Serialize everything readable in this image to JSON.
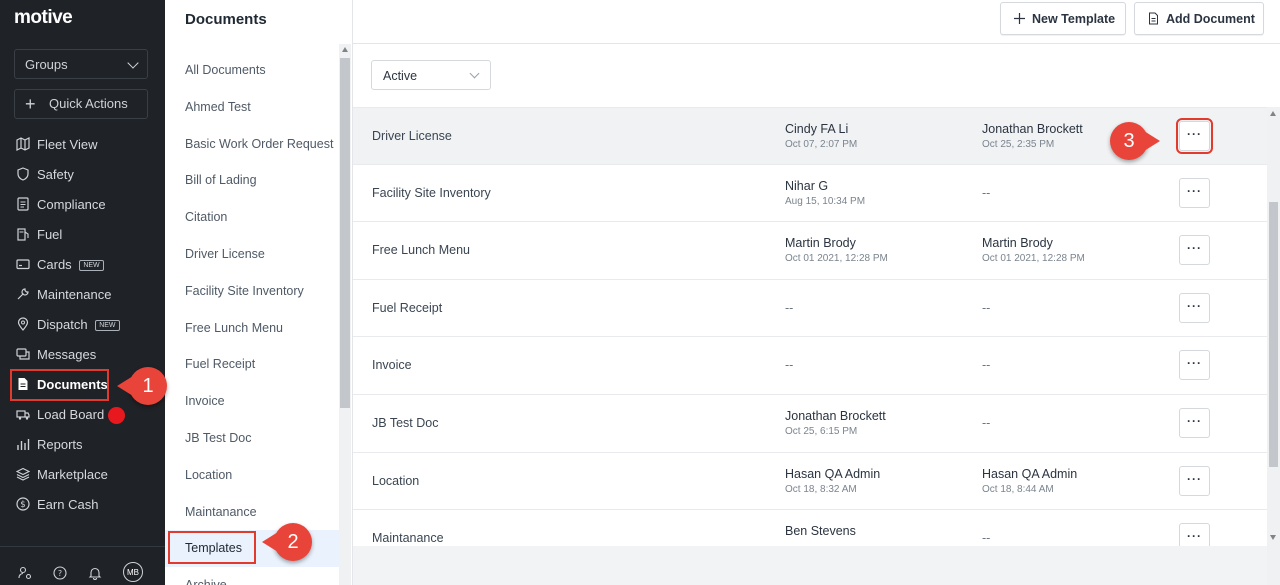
{
  "app": {
    "logo": "motive"
  },
  "sidebar": {
    "groups_label": "Groups",
    "quick_actions_label": "Quick Actions",
    "items": [
      {
        "label": "Fleet View",
        "icon": "map-icon"
      },
      {
        "label": "Safety",
        "icon": "shield-icon"
      },
      {
        "label": "Compliance",
        "icon": "clipboard-icon"
      },
      {
        "label": "Fuel",
        "icon": "fuel-icon"
      },
      {
        "label": "Cards",
        "icon": "card-icon",
        "badge": "NEW"
      },
      {
        "label": "Maintenance",
        "icon": "wrench-icon"
      },
      {
        "label": "Dispatch",
        "icon": "location-pin-icon",
        "badge": "NEW"
      },
      {
        "label": "Messages",
        "icon": "chat-icon"
      },
      {
        "label": "Documents",
        "icon": "document-icon",
        "active": true
      },
      {
        "label": "Load Board",
        "icon": "truck-icon"
      },
      {
        "label": "Reports",
        "icon": "bar-chart-icon"
      },
      {
        "label": "Marketplace",
        "icon": "layers-icon"
      },
      {
        "label": "Earn Cash",
        "icon": "dollar-icon"
      }
    ],
    "avatar_initials": "MB"
  },
  "header": {
    "title": "Documents",
    "new_template_label": "New Template",
    "add_document_label": "Add Document"
  },
  "templates": {
    "items": [
      "All Documents",
      "Ahmed Test",
      "Basic Work Order Request",
      "Bill of Lading",
      "Citation",
      "Driver License",
      "Facility Site Inventory",
      "Free Lunch Menu",
      "Fuel Receipt",
      "Invoice",
      "JB Test Doc",
      "Location",
      "Maintanance",
      "Templates",
      "Archive"
    ],
    "selected": "Templates"
  },
  "filter": {
    "status_value": "Active"
  },
  "table": {
    "rows": [
      {
        "name": "Driver License",
        "created_by": "Cindy FA Li",
        "created_at": "Oct 07, 2:07 PM",
        "modified_by": "Jonathan Brockett",
        "modified_at": "Oct 25, 2:35 PM"
      },
      {
        "name": "Facility Site Inventory",
        "created_by": "Nihar G",
        "created_at": "Aug 15, 10:34 PM",
        "modified_by": "--",
        "modified_at": ""
      },
      {
        "name": "Free Lunch Menu",
        "created_by": "Martin Brody",
        "created_at": "Oct 01 2021, 12:28 PM",
        "modified_by": "Martin Brody",
        "modified_at": "Oct 01 2021, 12:28 PM"
      },
      {
        "name": "Fuel Receipt",
        "created_by": "--",
        "created_at": "",
        "modified_by": "--",
        "modified_at": ""
      },
      {
        "name": "Invoice",
        "created_by": "--",
        "created_at": "",
        "modified_by": "--",
        "modified_at": ""
      },
      {
        "name": "JB Test Doc",
        "created_by": "Jonathan Brockett",
        "created_at": "Oct 25, 6:15 PM",
        "modified_by": "--",
        "modified_at": ""
      },
      {
        "name": "Location",
        "created_by": "Hasan QA Admin",
        "created_at": "Oct 18, 8:32 AM",
        "modified_by": "Hasan QA Admin",
        "modified_at": "Oct 18, 8:44 AM"
      },
      {
        "name": "Maintanance",
        "created_by": "Ben Stevens",
        "created_at": "",
        "modified_by": "--",
        "modified_at": ""
      }
    ],
    "more_label": "···"
  },
  "callouts": {
    "one": "1",
    "two": "2",
    "three": "3"
  },
  "colors": {
    "sidebar_bg": "#1f2226",
    "highlight_red": "#e23a2c",
    "callout_red": "#e8443a",
    "selected_bg": "#eaf2fd"
  }
}
